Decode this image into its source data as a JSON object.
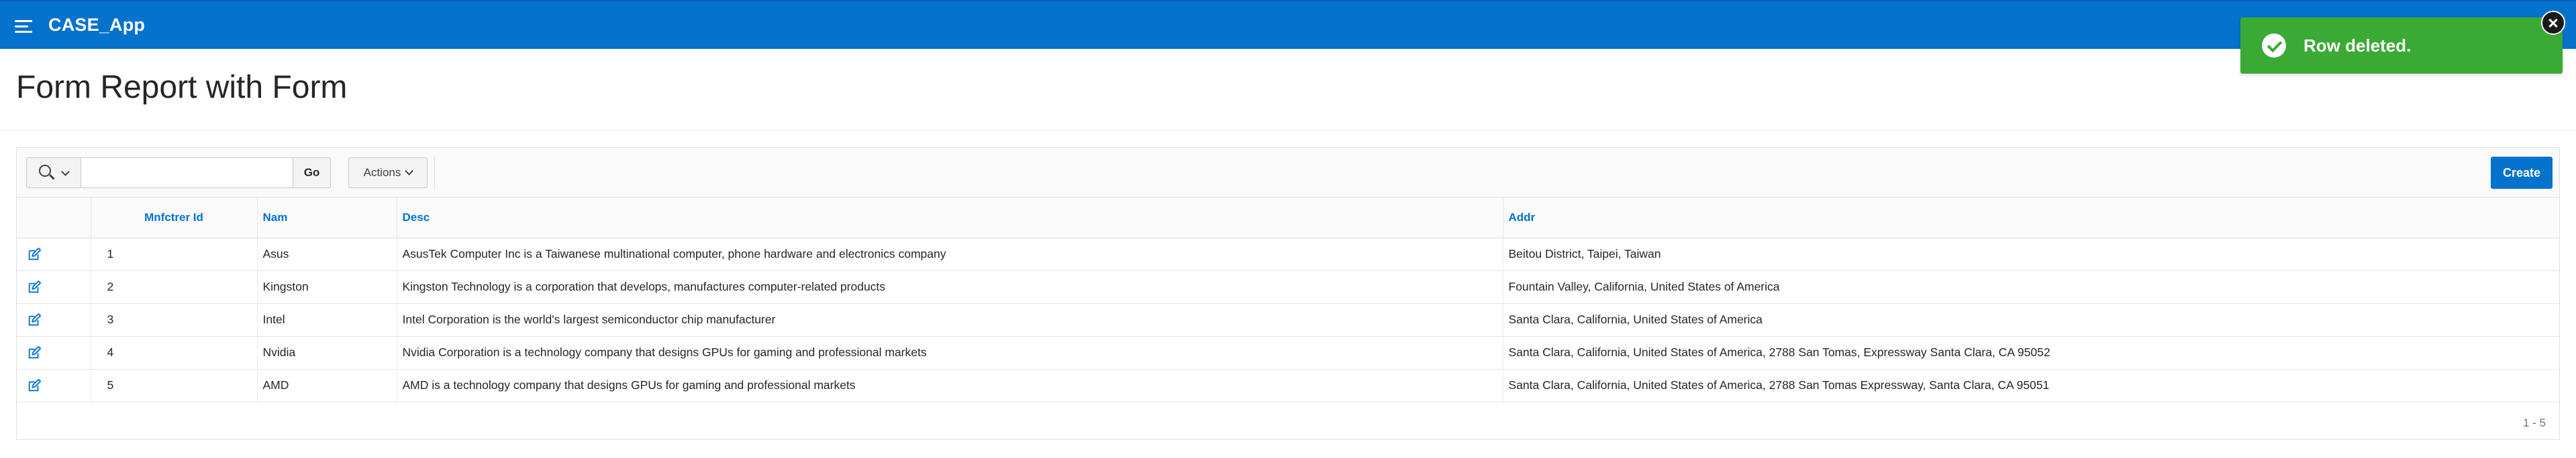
{
  "header": {
    "app_title": "CASE_App",
    "menu_icon": "hamburger-menu-icon",
    "background_color": "#0572ce"
  },
  "page": {
    "title": "Form Report with Form"
  },
  "toolbar": {
    "search_icon": "search-icon",
    "search_placeholder": "",
    "search_value": "",
    "go_label": "Go",
    "actions_label": "Actions",
    "create_label": "Create"
  },
  "table": {
    "columns": [
      "Mnfctrer Id",
      "Nam",
      "Desc",
      "Addr"
    ],
    "rows": [
      {
        "id": "1",
        "nam": "Asus",
        "desc": "AsusTek Computer Inc is a Taiwanese multinational computer, phone hardware and electronics company",
        "addr": "Beitou District, Taipei, Taiwan"
      },
      {
        "id": "2",
        "nam": "Kingston",
        "desc": "Kingston Technology is a corporation that develops, manufactures computer-related products",
        "addr": "Fountain Valley, California, United States of America"
      },
      {
        "id": "3",
        "nam": "Intel",
        "desc": "Intel Corporation is the world's largest semiconductor chip manufacturer",
        "addr": "Santa Clara, California, United States of America"
      },
      {
        "id": "4",
        "nam": "Nvidia",
        "desc": "Nvidia Corporation is a technology company that designs GPUs for gaming and professional markets",
        "addr": "Santa Clara, California, United States of America, 2788 San Tomas, Expressway Santa Clara, CA 95052"
      },
      {
        "id": "5",
        "nam": "AMD",
        "desc": "AMD is a technology company that designs GPUs for gaming and professional markets",
        "addr": "Santa Clara, California, United States of America, 2788 San Tomas Expressway, Santa Clara, CA 95051"
      }
    ],
    "range_label": "1 - 5",
    "edit_icon": "edit-icon"
  },
  "toast": {
    "message": "Row deleted.",
    "icon": "check-circle-icon",
    "close_icon": "close-icon",
    "color": "#3aaa35"
  }
}
